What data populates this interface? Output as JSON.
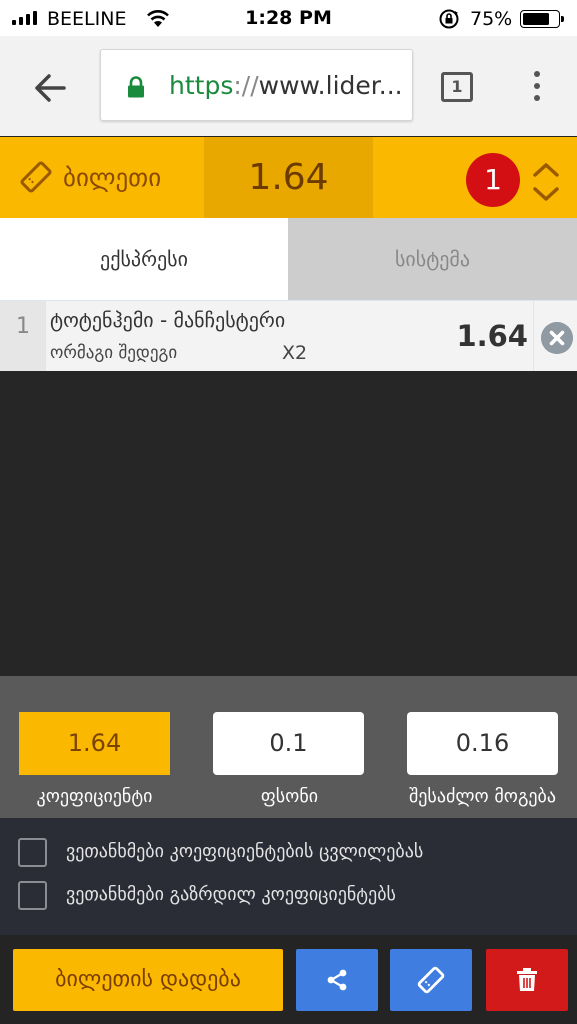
{
  "status_bar": {
    "carrier": "BEELINE",
    "time": "1:28 PM",
    "battery_percent": "75%",
    "battery_level": 0.75
  },
  "browser": {
    "url_scheme": "https",
    "url_sep": "://",
    "url_rest": "www.lider...",
    "tab_count": "1"
  },
  "ticket": {
    "label": "ბილეთი",
    "total_odds": "1.64",
    "selection_count": "1"
  },
  "tabs": [
    {
      "label": "ექსპრესი",
      "active": true
    },
    {
      "label": "სისტემა",
      "active": false
    }
  ],
  "bet": {
    "index": "1",
    "match": "ტოტენჰემი - მანჩესტერი",
    "market": "ორმაგი შედეგი",
    "outcome": "X2",
    "odds": "1.64"
  },
  "stake_panel": {
    "coefficient_value": "1.64",
    "coefficient_label": "კოეფიციენტი",
    "stake_value": "0.1",
    "stake_label": "ფსონი",
    "win_value": "0.16",
    "win_label": "შესაძლო მოგება"
  },
  "options": [
    {
      "label": "ვეთანხმები კოეფიციენტების ცვლილებას",
      "checked": false
    },
    {
      "label": "ვეთანხმები გაზრდილ კოეფიციენტებს",
      "checked": false
    }
  ],
  "actions": {
    "place_bet_label": "ბილეთის დადება"
  },
  "colors": {
    "brand_yellow": "#fbb800",
    "action_blue": "#3f7de0",
    "danger_red": "#d21a1a",
    "badge_red": "#d40f14"
  },
  "icons": [
    "signal-icon",
    "wifi-icon",
    "rotation-lock-icon",
    "battery-icon",
    "back-arrow-icon",
    "padlock-icon",
    "tabs-icon",
    "kebab-menu-icon",
    "ticket-icon",
    "expand-collapse-icon",
    "close-icon",
    "share-icon",
    "ticket-icon",
    "trash-icon"
  ]
}
